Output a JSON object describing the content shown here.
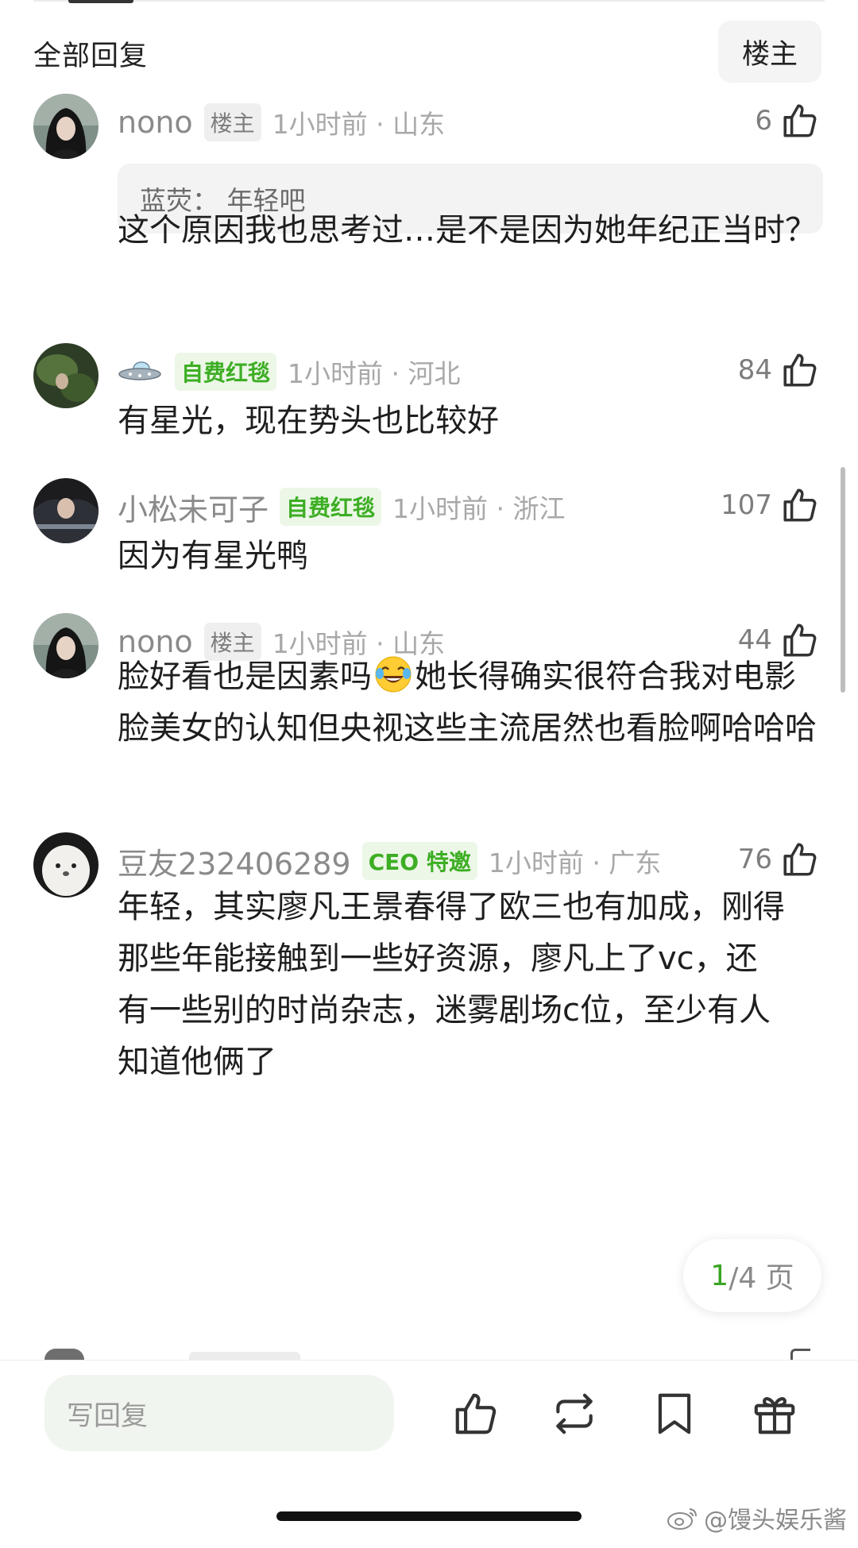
{
  "header": {
    "title": "全部回复",
    "owner_filter": "楼主"
  },
  "comments": [
    {
      "username": "nono",
      "badge": "楼主",
      "time": "1小时前 · 山东",
      "likes": "6",
      "quote": "蓝荧：  年轻吧",
      "text": "这个原因我也思考过…是不是因为她年纪正当时？"
    },
    {
      "username": "",
      "avatar_icon": "ufo-icon",
      "badge": "自费红毯",
      "time": "1小时前 · 河北",
      "likes": "84",
      "text": "有星光，现在势头也比较好"
    },
    {
      "username": "小松未可子",
      "badge": "自费红毯",
      "time": "1小时前 · 浙江",
      "likes": "107",
      "text": "因为有星光鸭"
    },
    {
      "username": "nono",
      "badge": "楼主",
      "time": "1小时前 · 山东",
      "likes": "44",
      "text_before": "脸好看也是因素吗",
      "emoji": "tears-of-joy-emoji",
      "text_after": "她长得确实很符合我对电影脸美女的认知但央视这些主流居然也看脸啊哈哈哈"
    },
    {
      "username": "豆友232406289",
      "badge": "CEO 特邀",
      "time": "1小时前 · 广东",
      "likes": "76",
      "text": "年轻，其实廖凡王景春得了欧三也有加成，刚得那些年能接触到一些好资源，廖凡上了vc，还有一些别的时尚杂志，迷雾剧场c位，至少有人知道他俩了"
    }
  ],
  "pagination": {
    "current": "1",
    "total": "/4 页"
  },
  "bottom_bar": {
    "reply_placeholder": "写回复",
    "actions": [
      "like-icon",
      "repost-icon",
      "bookmark-icon",
      "gift-icon"
    ]
  },
  "watermark": "@馒头娱乐酱",
  "colors": {
    "green": "#3dae24",
    "badge_green_bg": "#ecf7e7",
    "input_bg": "#f1f5ef"
  }
}
